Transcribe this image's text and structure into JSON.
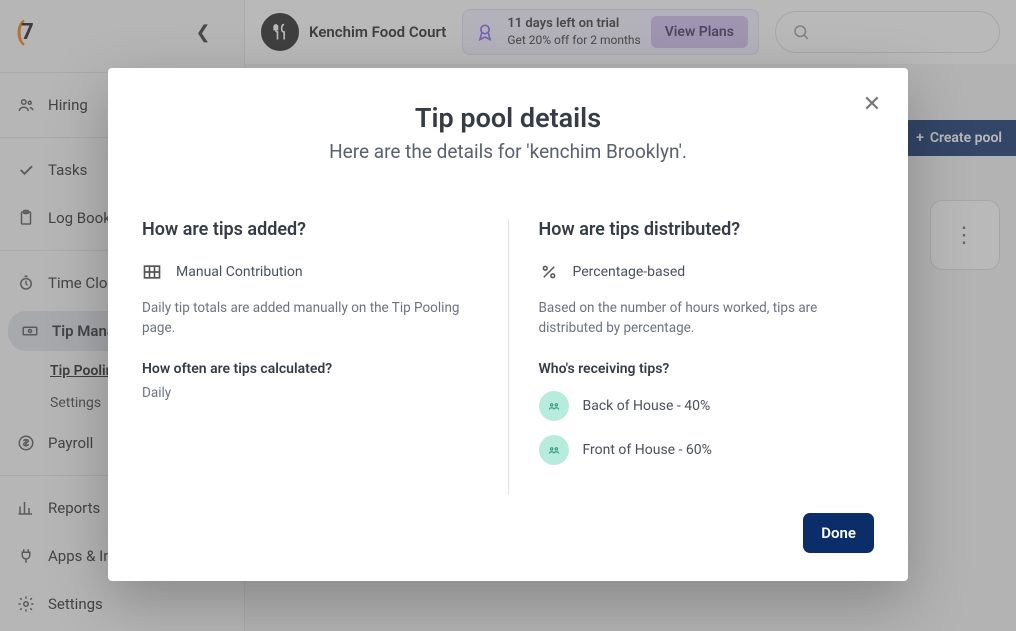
{
  "logo_text": "7",
  "header": {
    "org_name": "Kenchim Food Court",
    "trial_line1": "11 days left on trial",
    "trial_line2": "Get 20% off for 2 months",
    "view_plans": "View Plans",
    "create_pool": "Create pool"
  },
  "sidebar": {
    "items": [
      {
        "label": "Hiring"
      },
      {
        "label": "Tasks"
      },
      {
        "label": "Log Book"
      },
      {
        "label": "Time Clocking"
      },
      {
        "label": "Tip Management"
      },
      {
        "label": "Payroll"
      },
      {
        "label": "Reports"
      },
      {
        "label": "Apps & Integrations"
      },
      {
        "label": "Settings"
      }
    ],
    "sub": {
      "tip_pooling": "Tip Pooling",
      "settings": "Settings"
    }
  },
  "modal": {
    "title": "Tip pool details",
    "subtitle": "Here are the details for 'kenchim Brooklyn'.",
    "done": "Done",
    "left": {
      "heading": "How are tips added?",
      "method": "Manual Contribution",
      "desc": "Daily tip totals are added manually on the Tip Pooling page.",
      "freq_h": "How often are tips calculated?",
      "freq_v": "Daily"
    },
    "right": {
      "heading": "How are tips distributed?",
      "method": "Percentage-based",
      "desc": "Based on the number of hours worked, tips are distributed by percentage.",
      "who_h": "Who's receiving tips?",
      "recipients": [
        {
          "label": "Back of House - 40%"
        },
        {
          "label": "Front of House - 60%"
        }
      ]
    }
  }
}
